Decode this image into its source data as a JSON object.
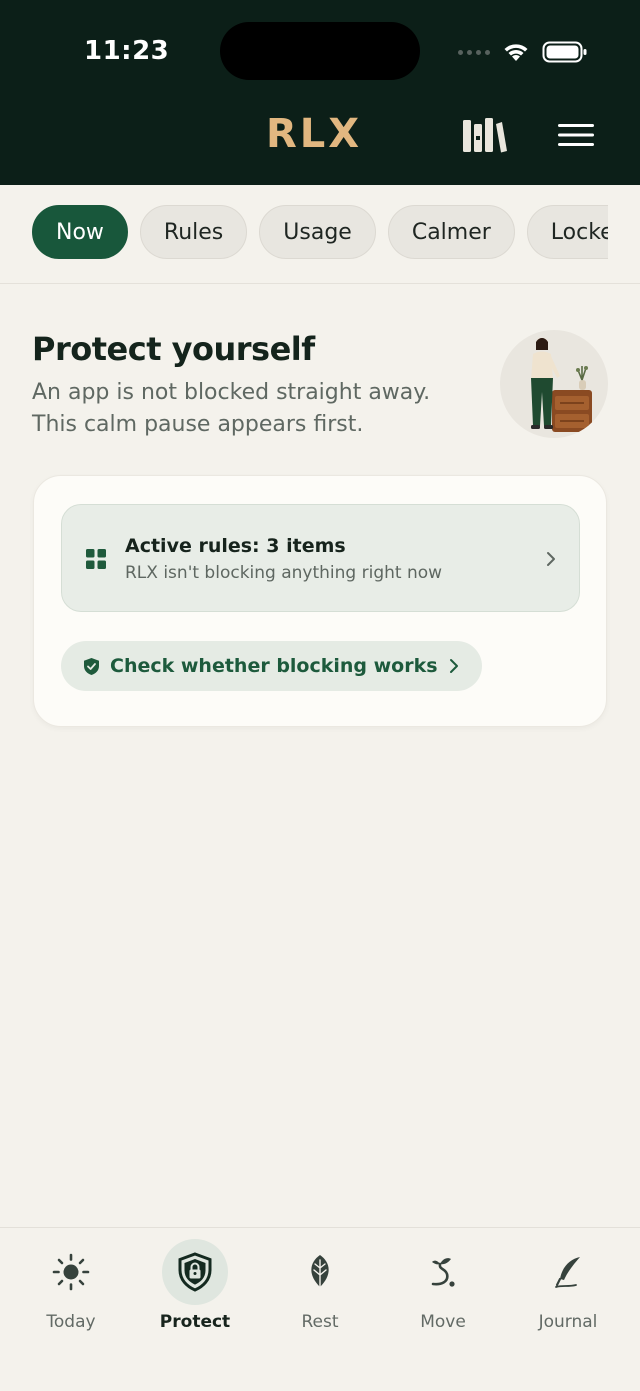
{
  "status_bar": {
    "time": "11:23"
  },
  "header": {
    "logo": "RLX",
    "library_icon": "library-books-icon",
    "menu_icon": "hamburger-menu-icon"
  },
  "tabs": [
    {
      "label": "Now",
      "active": true
    },
    {
      "label": "Rules",
      "active": false
    },
    {
      "label": "Usage",
      "active": false
    },
    {
      "label": "Calmer",
      "active": false
    },
    {
      "label": "Locked",
      "active": false
    }
  ],
  "hero": {
    "title": "Protect yourself",
    "subtitle": "An app is not blocked straight away. This calm pause appears first."
  },
  "card": {
    "rules": {
      "title": "Active rules: 3 items",
      "subtitle": "RLX isn't blocking anything right now"
    },
    "check_button": {
      "label": "Check whether blocking works"
    }
  },
  "bottom_nav": [
    {
      "label": "Today",
      "icon": "sun-icon",
      "active": false
    },
    {
      "label": "Protect",
      "icon": "shield-lock-icon",
      "active": true
    },
    {
      "label": "Rest",
      "icon": "leaf-icon",
      "active": false
    },
    {
      "label": "Move",
      "icon": "sprout-icon",
      "active": false
    },
    {
      "label": "Journal",
      "icon": "quill-icon",
      "active": false
    }
  ],
  "colors": {
    "header_bg": "#0c1f18",
    "brand_gold": "#e2b780",
    "accent_green": "#18573b",
    "page_bg": "#f4f2ec"
  }
}
